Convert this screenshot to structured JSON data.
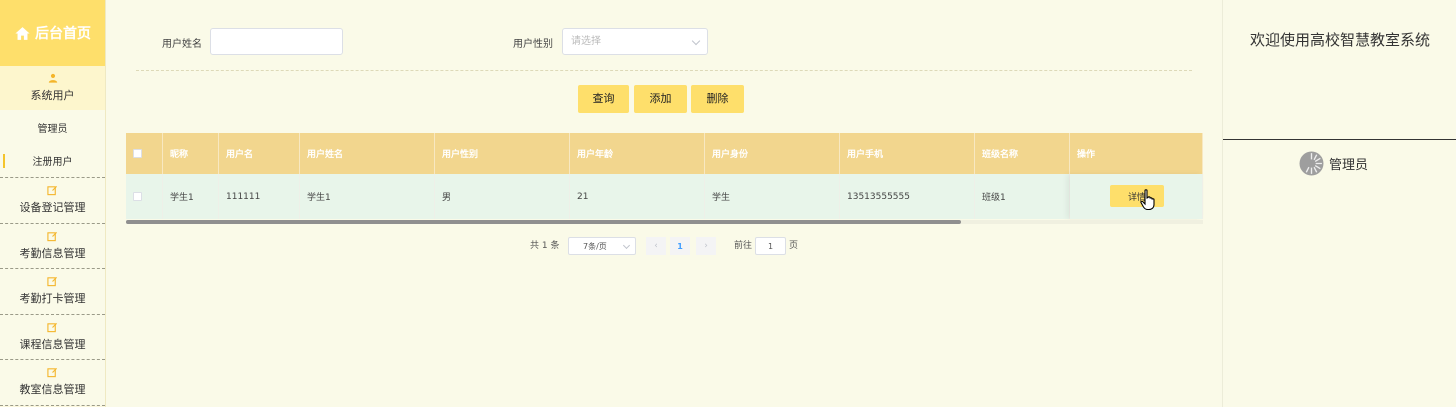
{
  "sidebar": {
    "logo": "后台首页",
    "section": "系统用户",
    "sub_items": [
      "管理员",
      "注册用户"
    ],
    "active_sub": "注册用户",
    "menu_items": [
      "设备登记管理",
      "考勤信息管理",
      "考勤打卡管理",
      "课程信息管理",
      "教室信息管理"
    ]
  },
  "search": {
    "name_label": "用户姓名",
    "name_value": "",
    "gender_label": "用户性别",
    "gender_placeholder": "请选择"
  },
  "toolbar": {
    "query": "查询",
    "add": "添加",
    "delete": "删除"
  },
  "table": {
    "headers": [
      "昵称",
      "用户名",
      "用户姓名",
      "用户性别",
      "用户年龄",
      "用户身份",
      "用户手机",
      "班级名称",
      "操作"
    ],
    "rows": [
      {
        "nickname": "学生1",
        "username": "111111",
        "name": "学生1",
        "gender": "男",
        "age": "21",
        "role": "学生",
        "phone": "13513555555",
        "class": "班级1",
        "action": "详情"
      }
    ]
  },
  "pagination": {
    "total": "共 1 条",
    "page_size": "7条/页",
    "current_page": "1",
    "goto_label": "前往",
    "goto_value": "1",
    "page_suffix": "页",
    "prev_icon": "chevron-left-icon",
    "next_icon": "chevron-right-icon"
  },
  "right_panel": {
    "welcome": "欢迎使用高校智慧教室系统",
    "user": "管理员"
  },
  "colors": {
    "accent": "#fedf6b",
    "table_header": "#f2d68e",
    "row_bg": "#e8f5ea",
    "page_bg": "#fafae8"
  }
}
